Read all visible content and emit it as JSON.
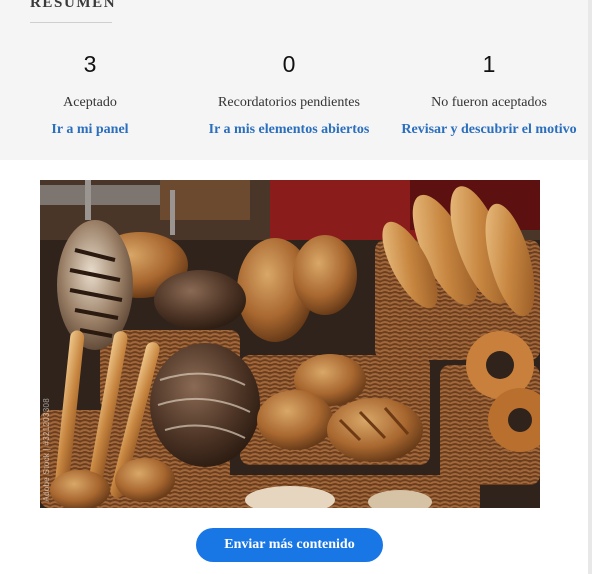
{
  "summary": {
    "title": "RESUMEN",
    "stats": [
      {
        "value": "3",
        "label": "Aceptado",
        "link": "Ir a mi panel"
      },
      {
        "value": "0",
        "label": "Recordatorios pendientes",
        "link": "Ir a mis elementos abiertos"
      },
      {
        "value": "1",
        "label": "No fueron aceptados",
        "link": "Revisar y descubrir el motivo"
      }
    ]
  },
  "image": {
    "watermark": "Adobe Stock | #321203308"
  },
  "cta": {
    "label": "Enviar más contenido"
  },
  "colors": {
    "accent": "#1877e5",
    "link": "#2a6ebe",
    "summary_bg": "#f5f5f5"
  }
}
